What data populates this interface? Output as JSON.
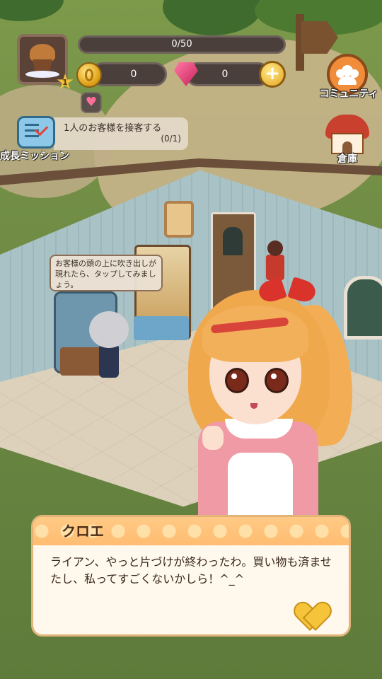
{
  "hud": {
    "xp": {
      "text": "0/50",
      "progress": 0
    },
    "coins": "0",
    "gems": "0",
    "level": "1",
    "plus_label": "+",
    "heart_label": "♥"
  },
  "mission": {
    "label": "成長ミッション",
    "task": "1人のお客様を接客する",
    "count": "(0/1)"
  },
  "side_buttons": {
    "community": "コミュニティ",
    "warehouse": "倉庫"
  },
  "tutorial_bubble": "お客様の頭の上に吹き出しが現れたら、タップしてみましょう。",
  "dialog": {
    "speaker": "クロエ",
    "text": "ライアン、やっと片づけが終わったわ。買い物も済ませたし、私ってすごくないかしら！^_^"
  },
  "colors": {
    "hud_bg": "#4a3f3a",
    "dialog_header": "#ffc985",
    "accent_gold": "#f6c43a",
    "gem": "#d82f68"
  },
  "icons": {
    "avatar": "muffin-icon",
    "coin": "coin-icon",
    "gem": "gem-icon",
    "mission": "checklist-icon",
    "community": "people-icon",
    "warehouse": "house-icon",
    "next": "heart-icon"
  }
}
